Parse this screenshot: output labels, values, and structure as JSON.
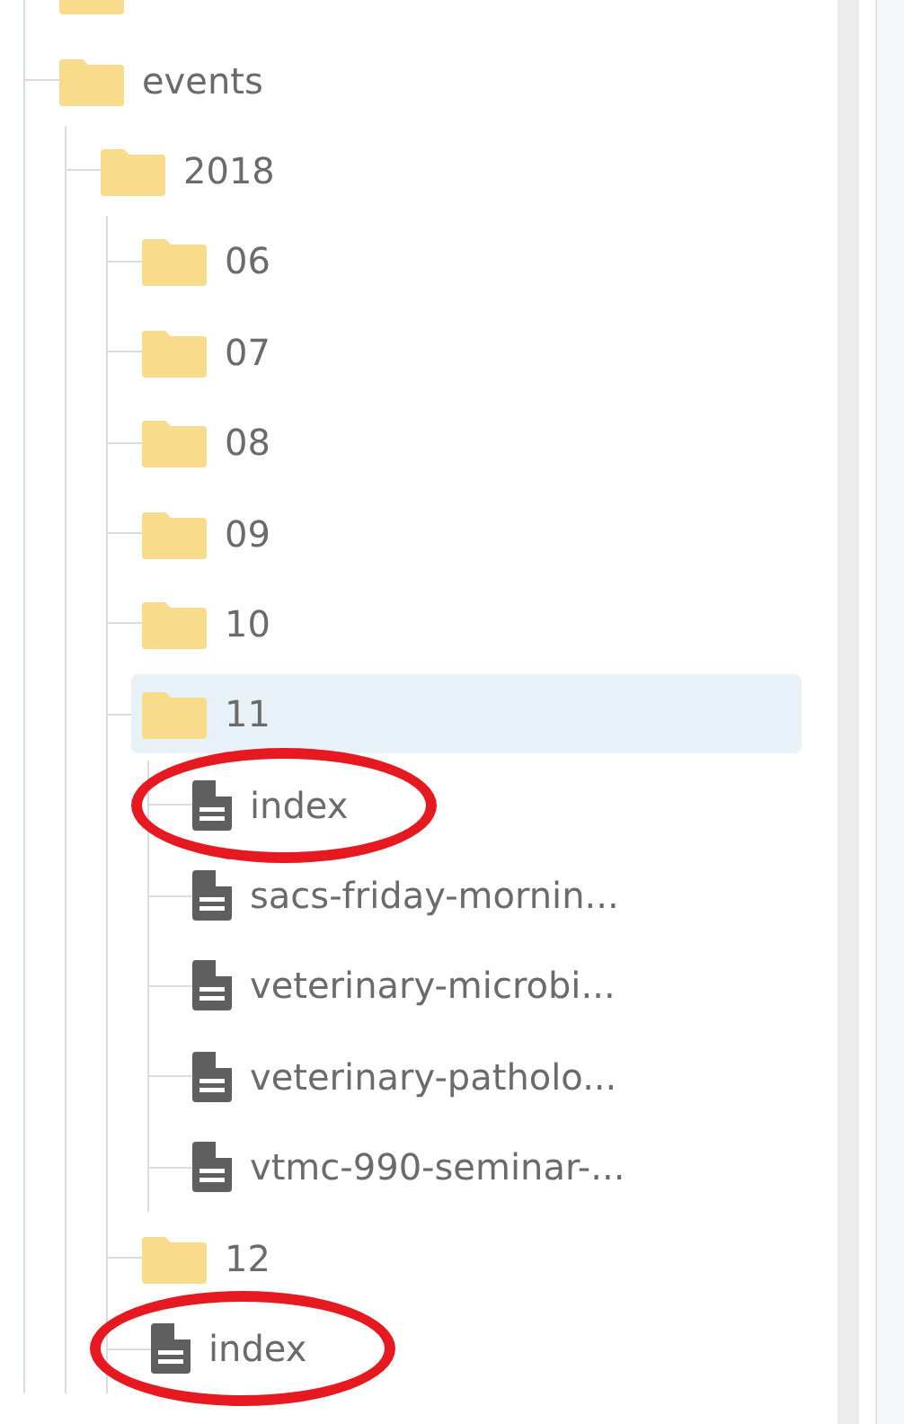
{
  "tree": [
    {
      "kind": "folder",
      "selected": false,
      "circled": false
    },
    {
      "kind": "folder",
      "label": "events",
      "selected": false,
      "circled": false,
      "children": [
        {
          "kind": "folder",
          "label": "2018",
          "selected": false,
          "circled": false,
          "children": [
            {
              "kind": "folder",
              "label": "06",
              "selected": false,
              "circled": false
            },
            {
              "kind": "folder",
              "label": "07",
              "selected": false,
              "circled": false
            },
            {
              "kind": "folder",
              "label": "08",
              "selected": false,
              "circled": false
            },
            {
              "kind": "folder",
              "label": "09",
              "selected": false,
              "circled": false
            },
            {
              "kind": "folder",
              "label": "10",
              "selected": false,
              "circled": false
            },
            {
              "kind": "folder",
              "label": "11",
              "selected": true,
              "circled": false,
              "children": [
                {
                  "kind": "file",
                  "label": "index",
                  "selected": false,
                  "circled": true
                },
                {
                  "kind": "file",
                  "label": "sacs-friday-mornin...",
                  "selected": false,
                  "circled": false
                },
                {
                  "kind": "file",
                  "label": "veterinary-microbi...",
                  "selected": false,
                  "circled": false
                },
                {
                  "kind": "file",
                  "label": "veterinary-patholo...",
                  "selected": false,
                  "circled": false
                },
                {
                  "kind": "file",
                  "label": "vtmc-990-seminar-...",
                  "selected": false,
                  "circled": false
                }
              ]
            },
            {
              "kind": "folder",
              "label": "12",
              "selected": false,
              "circled": false
            },
            {
              "kind": "file",
              "label": "index",
              "selected": false,
              "circled": true
            }
          ]
        }
      ]
    }
  ]
}
